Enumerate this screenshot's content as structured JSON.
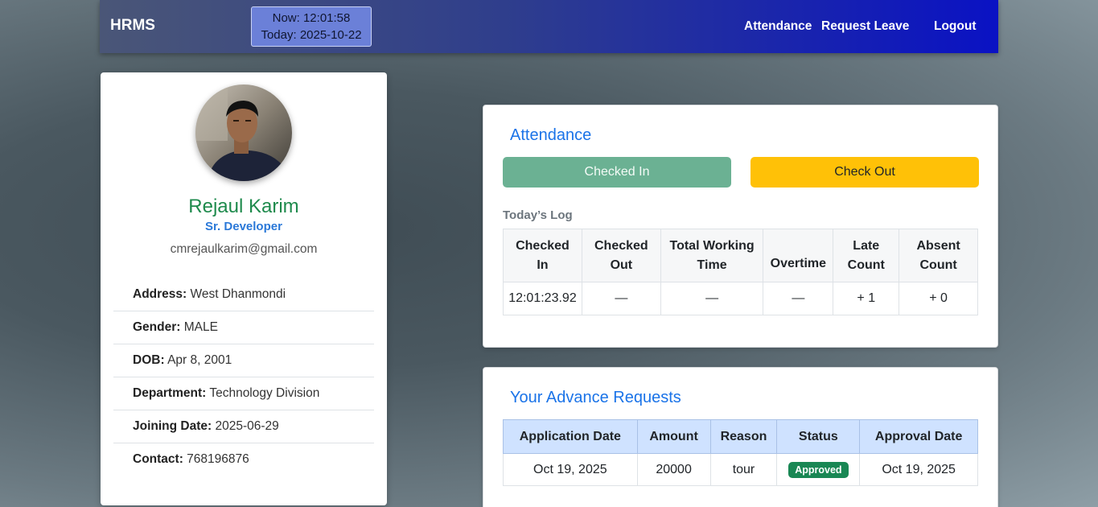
{
  "navbar": {
    "brand": "HRMS",
    "clock_now": "Now: 12:01:58",
    "clock_today": "Today: 2025-10-22",
    "links": [
      "Attendance",
      "Request Leave",
      "Logout"
    ]
  },
  "profile": {
    "name": "Rejaul Karim",
    "role": "Sr. Developer",
    "email": "cmrejaulkarim@gmail.com",
    "info": [
      {
        "label": "Address:",
        "value": "West Dhanmondi"
      },
      {
        "label": "Gender:",
        "value": "MALE"
      },
      {
        "label": "DOB:",
        "value": "Apr 8, 2001"
      },
      {
        "label": "Department:",
        "value": "Technology Division"
      },
      {
        "label": "Joining Date:",
        "value": "2025-06-29"
      },
      {
        "label": "Contact:",
        "value": "768196876"
      }
    ]
  },
  "attendance": {
    "title": "Attendance",
    "checked_in_label": "Checked In",
    "check_out_label": "Check Out",
    "log_label": "Today’s Log",
    "headers": [
      "Checked In",
      "Checked Out",
      "Total Working Time",
      "Overtime",
      "Late Count",
      "Absent Count"
    ],
    "row": [
      "12:01:23.92",
      "—",
      "—",
      "—",
      "+ 1",
      "+ 0"
    ]
  },
  "advance": {
    "title": "Your Advance Requests",
    "headers": [
      "Application Date",
      "Amount",
      "Reason",
      "Status",
      "Approval Date"
    ],
    "row": {
      "application_date": "Oct 19, 2025",
      "amount": "20000",
      "reason": "tour",
      "status": "Approved",
      "approval_date": "Oct 19, 2025"
    }
  },
  "colors": {
    "accent": "#1a73e8",
    "name_green": "#1e8a4c",
    "checked_in": "#6bb193",
    "check_out": "#ffc107",
    "approved_badge": "#198754"
  }
}
